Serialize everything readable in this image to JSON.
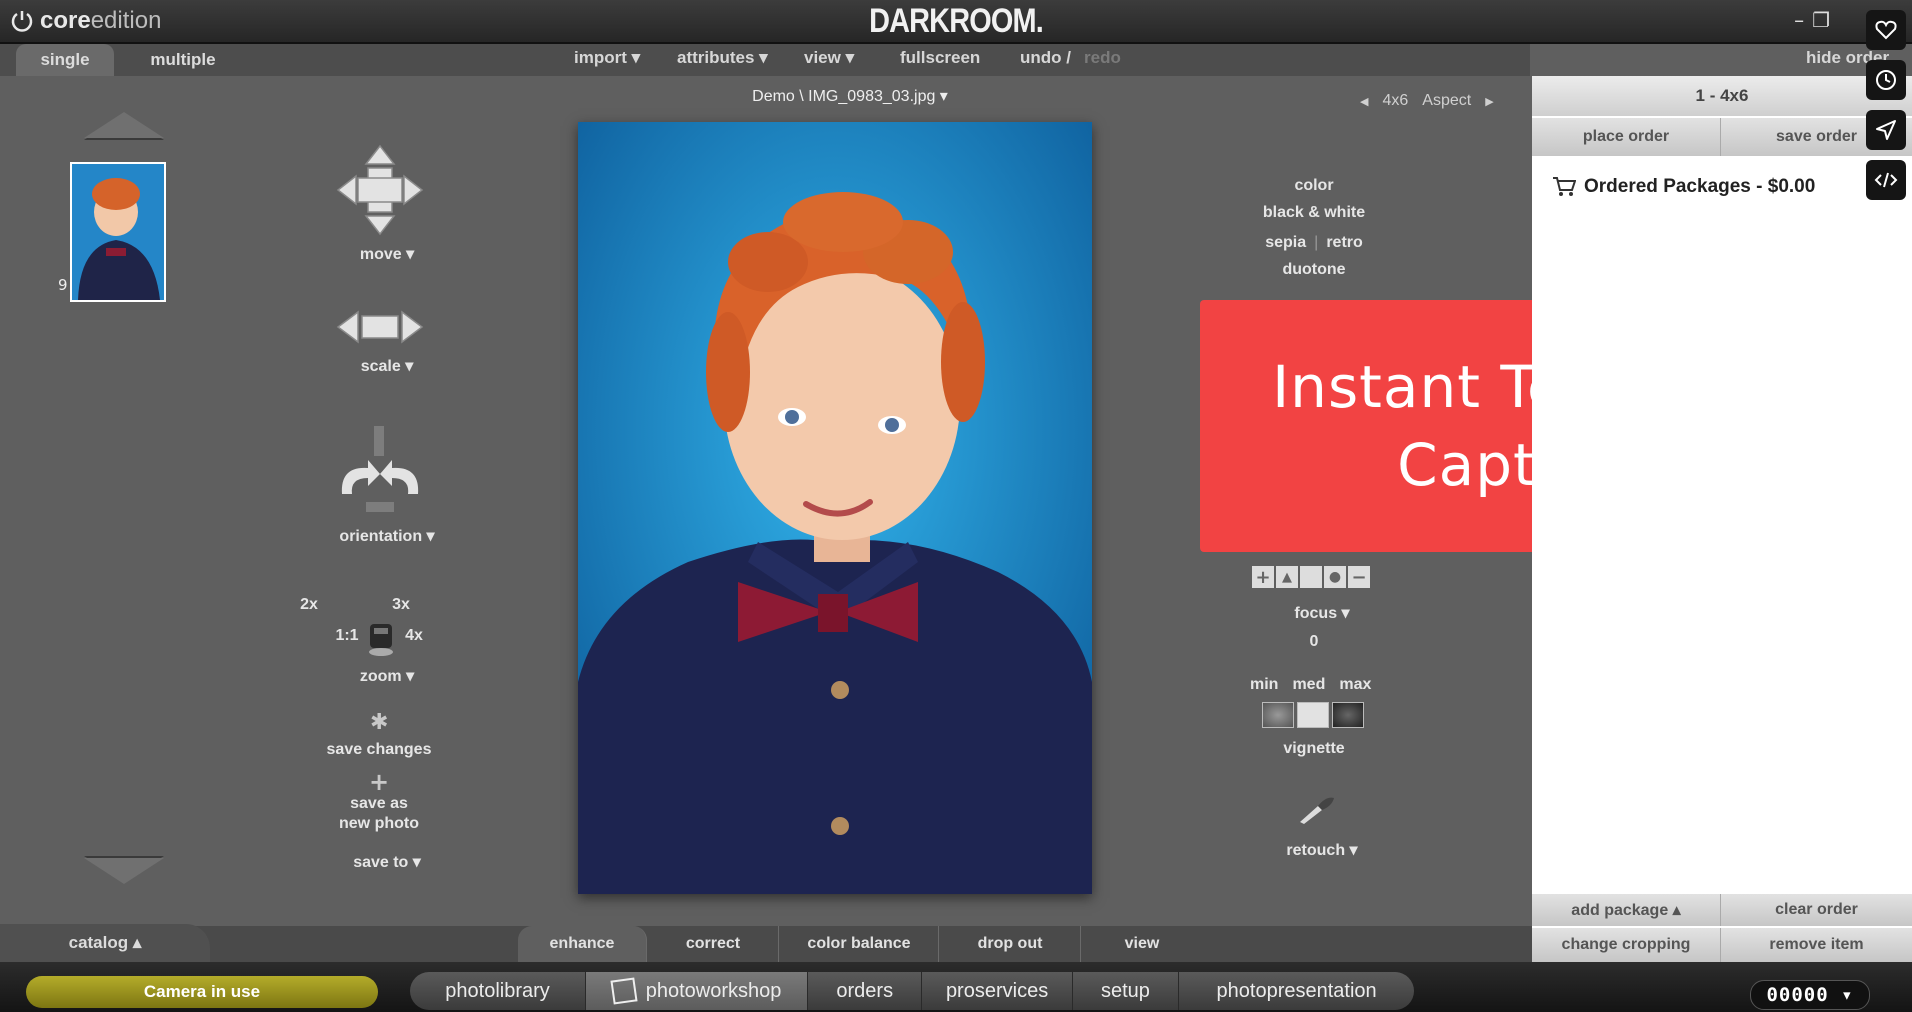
{
  "app": {
    "logo_bold": "core",
    "logo_normal": "edition",
    "brand": "DARKROOM.",
    "hide_order": "hide order"
  },
  "view_tabs": [
    "single",
    "multiple"
  ],
  "menu": {
    "import": "import ▾",
    "attributes": "attributes ▾",
    "view": "view ▾",
    "fullscreen": "fullscreen",
    "undo": "undo /",
    "redo": "redo"
  },
  "image": {
    "filename": "Demo \\ IMG_0983_03.jpg ▾",
    "aspect_size": "4x6",
    "aspect_label": "Aspect"
  },
  "thumbnail": {
    "number": "9"
  },
  "left_tools": {
    "move": "move ▾",
    "scale": "scale ▾",
    "orientation": "orientation ▾",
    "zoom_2x": "2x",
    "zoom_3x": "3x",
    "zoom_1_1": "1:1",
    "zoom_4x": "4x",
    "zoom": "zoom ▾",
    "save_changes": "save changes",
    "save_as_line1": "save as",
    "save_as_line2": "new photo",
    "save_to": "save to ▾"
  },
  "right_tools": {
    "color": "color",
    "black_white": "black & white",
    "sepia": "sepia",
    "separator": "|",
    "retro": "retro",
    "duotone": "duotone",
    "focus": "focus ▾",
    "focus_value": "0",
    "vignette_min": "min",
    "vignette_med": "med",
    "vignette_max": "max",
    "vignette": "vignette",
    "retouch": "retouch ▾"
  },
  "promo": {
    "line1": "Instant Tethered",
    "line2": "Capture"
  },
  "order_panel": {
    "header": "1 - 4x6",
    "place_order": "place order",
    "save_order": "save order",
    "ordered_packages": "Ordered Packages - $0.00",
    "add_package": "add package ▴",
    "clear_order": "clear order",
    "change_cropping": "change cropping",
    "remove_item": "remove item"
  },
  "bottom_tabs": {
    "catalog": "catalog ▴",
    "enhance": "enhance",
    "correct": "correct",
    "color_balance": "color balance",
    "drop_out": "drop out",
    "view": "view"
  },
  "status": {
    "camera": "Camera in use",
    "counter": "00000 ▾"
  },
  "app_nav": [
    "photolibrary",
    "photoworkshop",
    "orders",
    "proservices",
    "setup",
    "photopresentation"
  ],
  "colors": {
    "promo": "#f24343",
    "camera_indicator": "#9c9420",
    "background": "#5f5f5f"
  }
}
